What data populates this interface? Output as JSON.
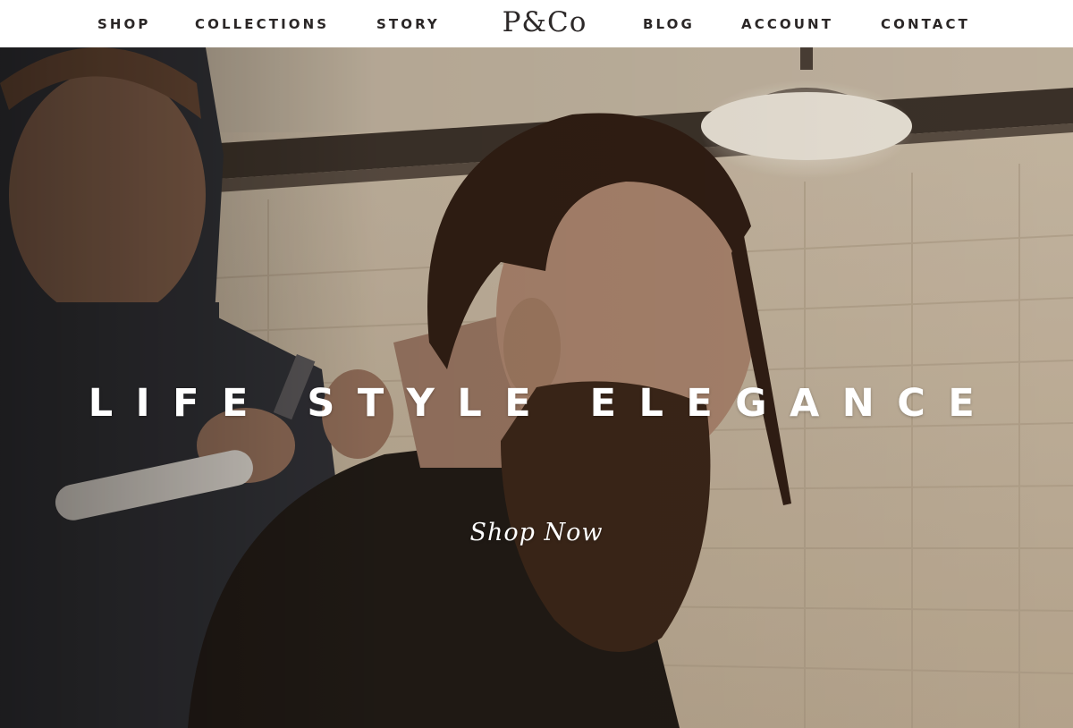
{
  "nav": {
    "left_items": [
      {
        "label": "SHOP"
      },
      {
        "label": "COLLECTIONS"
      },
      {
        "label": "STORY"
      }
    ],
    "logo": "P&Co",
    "right_items": [
      {
        "label": "BLOG"
      },
      {
        "label": "ACCOUNT"
      },
      {
        "label": "CONTACT"
      }
    ]
  },
  "hero": {
    "headline": "LIFE STYLE ELEGANCE",
    "cta_label": "Shop Now",
    "image_description_icon": "barbershop-photo"
  },
  "colors": {
    "nav_text": "#2a2626",
    "nav_background": "#ffffff",
    "hero_text": "#ffffff"
  }
}
